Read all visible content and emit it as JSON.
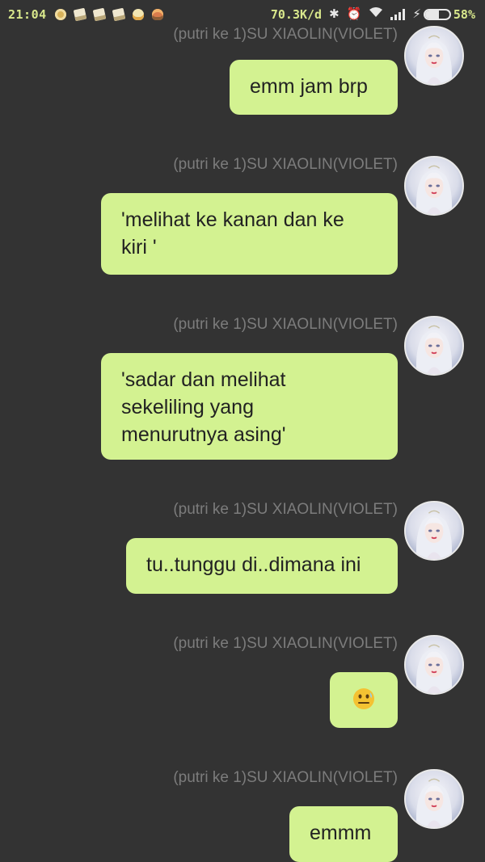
{
  "status_bar": {
    "time": "21:04",
    "notification_icons": [
      "pizza-icon",
      "card-icon",
      "card-icon",
      "card-icon",
      "duck-icon",
      "burger-icon"
    ],
    "net_speed": "70.3K/d",
    "icons": [
      "bluetooth-icon",
      "alarm-icon",
      "wifi-icon",
      "signal-icon",
      "charging-icon"
    ],
    "battery_percent": "58%",
    "battery_level": 0.58
  },
  "colors": {
    "background": "#333333",
    "bubble": "#d3f291",
    "bubble_text": "#222222",
    "sender_text": "#7c7c7c"
  },
  "messages": [
    {
      "sender": "(putri ke 1)SU XIAOLIN(VIOLET)",
      "lines": [
        "emm jam brp"
      ]
    },
    {
      "sender": "(putri ke 1)SU XIAOLIN(VIOLET)",
      "lines": [
        "'melihat ke kanan dan ke",
        "kiri '"
      ]
    },
    {
      "sender": "(putri ke 1)SU XIAOLIN(VIOLET)",
      "lines": [
        "'sadar dan melihat",
        "sekeliling yang",
        "menurutnya asing'"
      ]
    },
    {
      "sender": "(putri ke 1)SU XIAOLIN(VIOLET)",
      "lines": [
        "tu..tunggu di..dimana ini"
      ]
    },
    {
      "sender": "(putri ke 1)SU XIAOLIN(VIOLET)",
      "emoji": "nervous-face-emoji"
    },
    {
      "sender": "(putri ke 1)SU XIAOLIN(VIOLET)",
      "lines": [
        "emmm"
      ]
    }
  ]
}
